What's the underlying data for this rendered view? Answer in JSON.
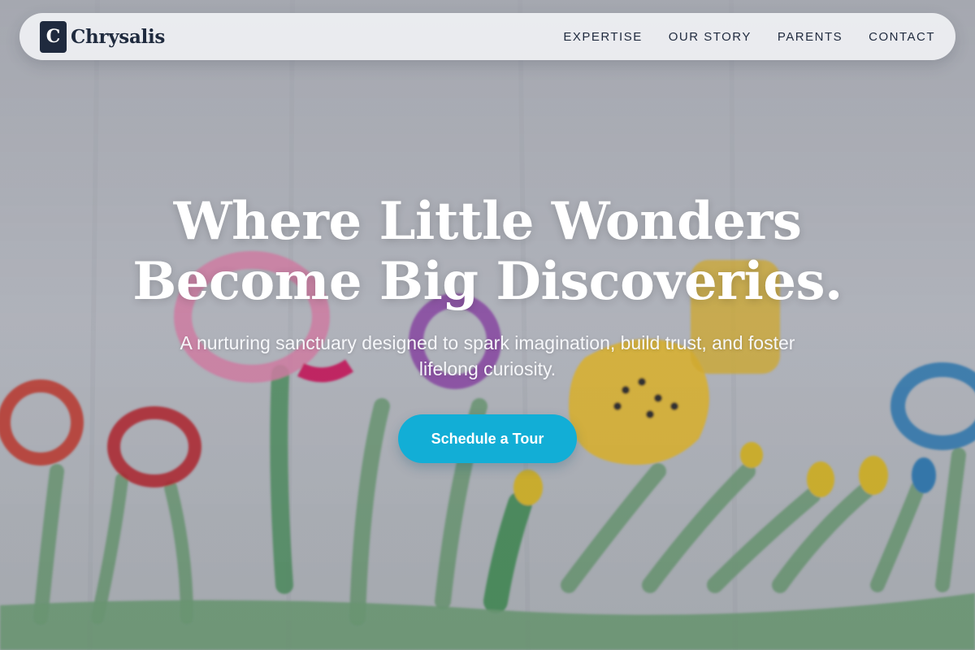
{
  "brand": {
    "mark": "C",
    "name": "Chrysalis"
  },
  "nav": {
    "items": [
      {
        "label": "EXPERTISE"
      },
      {
        "label": "OUR STORY"
      },
      {
        "label": "PARENTS"
      },
      {
        "label": "CONTACT"
      }
    ]
  },
  "hero": {
    "title_line1": "Where Little Wonders",
    "title_line2": "Become Big Discoveries.",
    "subtitle_line1": "A nurturing sanctuary designed to spark imagination, build trust, and foster",
    "subtitle_line2": "lifelong curiosity.",
    "cta_label": "Schedule a Tour",
    "background_image": "children's watercolor painting of flowers"
  },
  "colors": {
    "brand_dark": "#1f2a3e",
    "accent_cta": "#12aed6",
    "nav_bg": "#f0f1f3",
    "hero_text": "#ffffff"
  }
}
